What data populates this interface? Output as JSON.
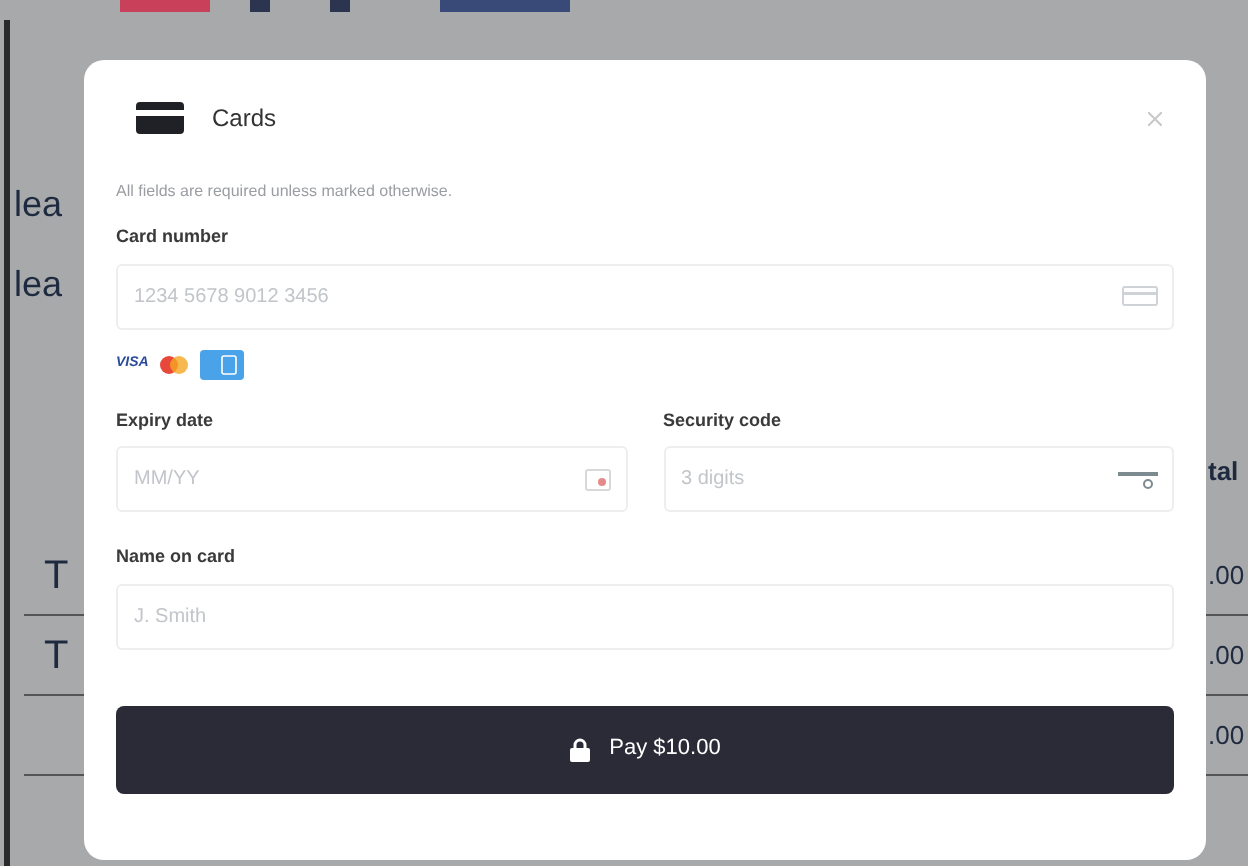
{
  "background": {
    "left_texts": [
      "lea",
      "lea"
    ],
    "right_header": "tal",
    "rows": [
      {
        "column_1": "T",
        "column_2": ".00"
      },
      {
        "column_1": "T",
        "column_2": ".00"
      },
      {
        "column_1": "",
        "column_2": ".00"
      }
    ]
  },
  "dialog": {
    "title": "Cards",
    "note": "All fields are required unless marked otherwise.",
    "fields": [
      {
        "label": "Card number",
        "placeholder": "1234 5678 9012 3456",
        "kind": "card"
      },
      {
        "label": "Expiry date",
        "placeholder": "MM/YY",
        "kind": "expiry"
      },
      {
        "label": "Security code",
        "placeholder": "3 digits",
        "kind": "cvc"
      },
      {
        "label": "Name on card",
        "placeholder": "J. Smith",
        "kind": "name"
      }
    ],
    "brand_text": "VISA",
    "pay_button": "Pay $10.00"
  }
}
